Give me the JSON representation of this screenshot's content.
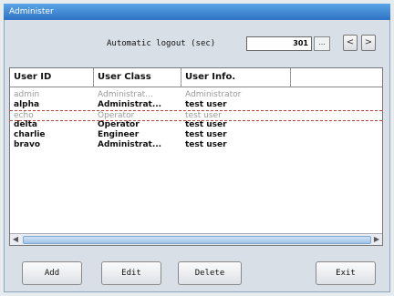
{
  "window": {
    "title": "Administer"
  },
  "logout": {
    "label": "Automatic logout (sec)",
    "value": "301",
    "more": "...",
    "prev": "<",
    "next": ">"
  },
  "table": {
    "columns": [
      "User ID",
      "User Class",
      "User Info."
    ],
    "rows": [
      {
        "id": "admin",
        "class": "Administrat...",
        "info": "Administrator",
        "state": "disabled"
      },
      {
        "id": "alpha",
        "class": "Administrat...",
        "info": "test user",
        "state": "active"
      },
      {
        "id": "echo",
        "class": "Operator",
        "info": "test user",
        "state": "disabled-selected"
      },
      {
        "id": "delta",
        "class": "Operator",
        "info": "test user",
        "state": "active"
      },
      {
        "id": "charlie",
        "class": "Engineer",
        "info": "test user",
        "state": "active"
      },
      {
        "id": "bravo",
        "class": "Administrat...",
        "info": "test user",
        "state": "active"
      }
    ]
  },
  "buttons": {
    "add": "Add",
    "edit": "Edit",
    "delete": "Delete",
    "exit": "Exit"
  }
}
